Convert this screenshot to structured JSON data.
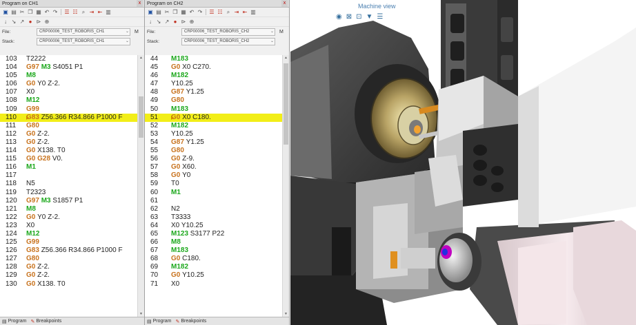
{
  "ch1": {
    "title": "Program on CH1",
    "close_label": "x",
    "file_label": "File:",
    "file_value": "CRP00006_TEST_ROBORIS_CH1",
    "stack_label": "Stack:",
    "stack_value": "CRP00006_TEST_ROBORIS_CH1",
    "m_label": "M",
    "lines": [
      {
        "num": "103",
        "segs": [
          {
            "t": "T2222",
            "c": ""
          }
        ]
      },
      {
        "num": "104",
        "segs": [
          {
            "t": "G97 ",
            "c": "o"
          },
          {
            "t": "M3 ",
            "c": "g"
          },
          {
            "t": "S4051 P1",
            "c": ""
          }
        ]
      },
      {
        "num": "105",
        "segs": [
          {
            "t": "M8",
            "c": "g"
          }
        ]
      },
      {
        "num": "106",
        "segs": [
          {
            "t": "G0 ",
            "c": "o"
          },
          {
            "t": "Y0 Z-2.",
            "c": ""
          }
        ]
      },
      {
        "num": "107",
        "segs": [
          {
            "t": "X0",
            "c": ""
          }
        ]
      },
      {
        "num": "108",
        "segs": [
          {
            "t": "M12",
            "c": "g"
          }
        ]
      },
      {
        "num": "109",
        "segs": [
          {
            "t": "G99",
            "c": "o"
          }
        ]
      },
      {
        "num": "110",
        "hl": true,
        "segs": [
          {
            "t": "G83 ",
            "c": "o"
          },
          {
            "t": "Z56.366 R34.866 P1000 F",
            "c": ""
          }
        ]
      },
      {
        "num": "111",
        "segs": [
          {
            "t": "G80",
            "c": "o"
          }
        ]
      },
      {
        "num": "112",
        "segs": [
          {
            "t": "G0 ",
            "c": "o"
          },
          {
            "t": "Z-2.",
            "c": ""
          }
        ]
      },
      {
        "num": "113",
        "segs": [
          {
            "t": "G0 ",
            "c": "o"
          },
          {
            "t": "Z-2.",
            "c": ""
          }
        ]
      },
      {
        "num": "114",
        "segs": [
          {
            "t": "G0 ",
            "c": "o"
          },
          {
            "t": "X138. T0",
            "c": ""
          }
        ]
      },
      {
        "num": "115",
        "segs": [
          {
            "t": "G0 ",
            "c": "o"
          },
          {
            "t": "G28 ",
            "c": "o"
          },
          {
            "t": "V0.",
            "c": ""
          }
        ]
      },
      {
        "num": "116",
        "segs": [
          {
            "t": "M1",
            "c": "g"
          }
        ]
      },
      {
        "num": "117",
        "segs": []
      },
      {
        "num": "118",
        "segs": [
          {
            "t": "N5",
            "c": ""
          }
        ]
      },
      {
        "num": "119",
        "segs": [
          {
            "t": "T2323",
            "c": ""
          }
        ]
      },
      {
        "num": "120",
        "segs": [
          {
            "t": "G97 ",
            "c": "o"
          },
          {
            "t": "M3 ",
            "c": "g"
          },
          {
            "t": "S1857 P1",
            "c": ""
          }
        ]
      },
      {
        "num": "121",
        "segs": [
          {
            "t": "M8",
            "c": "g"
          }
        ]
      },
      {
        "num": "122",
        "segs": [
          {
            "t": "G0 ",
            "c": "o"
          },
          {
            "t": "Y0 Z-2.",
            "c": ""
          }
        ]
      },
      {
        "num": "123",
        "segs": [
          {
            "t": "X0",
            "c": ""
          }
        ]
      },
      {
        "num": "124",
        "segs": [
          {
            "t": "M12",
            "c": "g"
          }
        ]
      },
      {
        "num": "125",
        "segs": [
          {
            "t": "G99",
            "c": "o"
          }
        ]
      },
      {
        "num": "126",
        "segs": [
          {
            "t": "G83 ",
            "c": "o"
          },
          {
            "t": "Z56.366 R34.866 P1000 F",
            "c": ""
          }
        ]
      },
      {
        "num": "127",
        "segs": [
          {
            "t": "G80",
            "c": "o"
          }
        ]
      },
      {
        "num": "128",
        "segs": [
          {
            "t": "G0 ",
            "c": "o"
          },
          {
            "t": "Z-2.",
            "c": ""
          }
        ]
      },
      {
        "num": "129",
        "segs": [
          {
            "t": "G0 ",
            "c": "o"
          },
          {
            "t": "Z-2.",
            "c": ""
          }
        ]
      },
      {
        "num": "130",
        "segs": [
          {
            "t": "G0 ",
            "c": "o"
          },
          {
            "t": "X138. T0",
            "c": ""
          }
        ]
      }
    ],
    "tabs": [
      "Program",
      "Breakpoints"
    ]
  },
  "ch2": {
    "title": "Program on CH2",
    "close_label": "x",
    "file_label": "File:",
    "file_value": "CRP00006_TEST_ROBORIS_CH2",
    "stack_label": "Stack:",
    "stack_value": "CRP00006_TEST_ROBORIS_CH2",
    "m_label": "M",
    "lines": [
      {
        "num": "44",
        "segs": [
          {
            "t": "M183",
            "c": "g"
          }
        ]
      },
      {
        "num": "45",
        "segs": [
          {
            "t": "G0 ",
            "c": "o"
          },
          {
            "t": "X0 C270.",
            "c": ""
          }
        ]
      },
      {
        "num": "46",
        "segs": [
          {
            "t": "M182",
            "c": "g"
          }
        ]
      },
      {
        "num": "47",
        "segs": [
          {
            "t": "Y10.25",
            "c": ""
          }
        ]
      },
      {
        "num": "48",
        "segs": [
          {
            "t": "G87 ",
            "c": "o"
          },
          {
            "t": "Y1.25",
            "c": ""
          }
        ]
      },
      {
        "num": "49",
        "segs": [
          {
            "t": "G80",
            "c": "o"
          }
        ]
      },
      {
        "num": "50",
        "segs": [
          {
            "t": "M183",
            "c": "g"
          }
        ]
      },
      {
        "num": "51",
        "hl": true,
        "segs": [
          {
            "t": "G0 ",
            "c": "o"
          },
          {
            "t": "X0 C180.",
            "c": ""
          }
        ]
      },
      {
        "num": "52",
        "segs": [
          {
            "t": "M182",
            "c": "g"
          }
        ]
      },
      {
        "num": "53",
        "segs": [
          {
            "t": "Y10.25",
            "c": ""
          }
        ]
      },
      {
        "num": "54",
        "segs": [
          {
            "t": "G87 ",
            "c": "o"
          },
          {
            "t": "Y1.25",
            "c": ""
          }
        ]
      },
      {
        "num": "55",
        "segs": [
          {
            "t": "G80",
            "c": "o"
          }
        ]
      },
      {
        "num": "56",
        "segs": [
          {
            "t": "G0 ",
            "c": "o"
          },
          {
            "t": "Z-9.",
            "c": ""
          }
        ]
      },
      {
        "num": "57",
        "segs": [
          {
            "t": "G0 ",
            "c": "o"
          },
          {
            "t": "X60.",
            "c": ""
          }
        ]
      },
      {
        "num": "58",
        "segs": [
          {
            "t": "G0 ",
            "c": "o"
          },
          {
            "t": "Y0",
            "c": ""
          }
        ]
      },
      {
        "num": "59",
        "segs": [
          {
            "t": "T0",
            "c": ""
          }
        ]
      },
      {
        "num": "60",
        "segs": [
          {
            "t": "M1",
            "c": "g"
          }
        ]
      },
      {
        "num": "61",
        "segs": []
      },
      {
        "num": "62",
        "segs": [
          {
            "t": "N2",
            "c": ""
          }
        ]
      },
      {
        "num": "63",
        "segs": [
          {
            "t": "T3333",
            "c": ""
          }
        ]
      },
      {
        "num": "64",
        "segs": [
          {
            "t": "X0 Y10.25",
            "c": ""
          }
        ]
      },
      {
        "num": "65",
        "segs": [
          {
            "t": "M123 ",
            "c": "g"
          },
          {
            "t": "S3177 P22",
            "c": ""
          }
        ]
      },
      {
        "num": "66",
        "segs": [
          {
            "t": "M8",
            "c": "g"
          }
        ]
      },
      {
        "num": "67",
        "segs": [
          {
            "t": "M183",
            "c": "g"
          }
        ]
      },
      {
        "num": "68",
        "segs": [
          {
            "t": "G0 ",
            "c": "o"
          },
          {
            "t": "C180.",
            "c": ""
          }
        ]
      },
      {
        "num": "69",
        "segs": [
          {
            "t": "M182",
            "c": "g"
          }
        ]
      },
      {
        "num": "70",
        "segs": [
          {
            "t": "G0 ",
            "c": "o"
          },
          {
            "t": "Y10.25",
            "c": ""
          }
        ]
      },
      {
        "num": "71",
        "segs": [
          {
            "t": "X0",
            "c": ""
          }
        ]
      }
    ],
    "tabs": [
      "Program",
      "Breakpoints"
    ]
  },
  "machine_view": {
    "title": "Machine view"
  },
  "colors": {
    "gcode": "#c8731e",
    "mcode": "#1ca81c",
    "highlight": "#f2ee18",
    "accent": "#4a7fb0"
  },
  "icons": [
    "save-icon",
    "cut-icon",
    "copy-icon",
    "paste-icon",
    "undo-icon",
    "redo-icon",
    "list-icon",
    "search-icon",
    "step-icon",
    "breakpoint-icon",
    "globe-icon"
  ]
}
